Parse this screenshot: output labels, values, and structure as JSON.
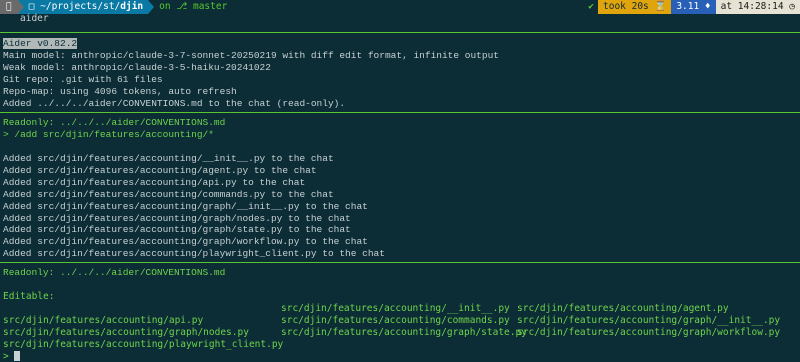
{
  "prompt": {
    "apple_icon": "apple-icon",
    "path_prefix": "~/projects/st/",
    "path_dir": "djin",
    "git_label": "on ⎇ master",
    "status_glyph": "✔",
    "took": "took 20s ⌛",
    "python_version": "3.11 ♦",
    "time": "at 14:28:14 ◷"
  },
  "command": "aider",
  "header_lines": [
    {
      "highlight": "Aider v0.82.2",
      "text": ""
    },
    {
      "highlight": "",
      "text": "Main model: anthropic/claude-3-7-sonnet-20250219 with diff edit format, infinite output"
    },
    {
      "highlight": "",
      "text": "Weak model: anthropic/claude-3-5-haiku-20241022"
    },
    {
      "highlight": "",
      "text": "Git repo: .git with 61 files"
    },
    {
      "highlight": "",
      "text": "Repo-map: using 4096 tokens, auto refresh"
    },
    {
      "highlight": "",
      "text": "Added ../../../aider/CONVENTIONS.md to the chat (read-only)."
    }
  ],
  "block2": {
    "readonly": "Readonly: ../../../aider/CONVENTIONS.md",
    "add_cmd": "> /add src/djin/features/accounting/*",
    "added": [
      "Added src/djin/features/accounting/__init__.py to the chat",
      "Added src/djin/features/accounting/agent.py to the chat",
      "Added src/djin/features/accounting/api.py to the chat",
      "Added src/djin/features/accounting/commands.py to the chat",
      "Added src/djin/features/accounting/graph/__init__.py to the chat",
      "Added src/djin/features/accounting/graph/nodes.py to the chat",
      "Added src/djin/features/accounting/graph/state.py to the chat",
      "Added src/djin/features/accounting/graph/workflow.py to the chat",
      "Added src/djin/features/accounting/playwright_client.py to the chat"
    ]
  },
  "block3": {
    "readonly": "Readonly: ../../../aider/CONVENTIONS.md",
    "editable_label": "Editable:",
    "files": [
      [
        "",
        "src/djin/features/accounting/__init__.py",
        "src/djin/features/accounting/agent.py"
      ],
      [
        "src/djin/features/accounting/api.py",
        "src/djin/features/accounting/commands.py",
        "src/djin/features/accounting/graph/__init__.py"
      ],
      [
        "src/djin/features/accounting/graph/nodes.py",
        "src/djin/features/accounting/graph/state.py",
        "src/djin/features/accounting/graph/workflow.py"
      ],
      [
        "src/djin/features/accounting/playwright_client.py",
        "",
        ""
      ]
    ],
    "input_prompt": ">"
  },
  "colors": {
    "background": "#0c2c36",
    "text": "#c7d1d3",
    "accent_green": "#6fd44b",
    "path_blue": "#0a7aa5",
    "took_yellow": "#e0a40c",
    "version_blue": "#2860b8"
  }
}
